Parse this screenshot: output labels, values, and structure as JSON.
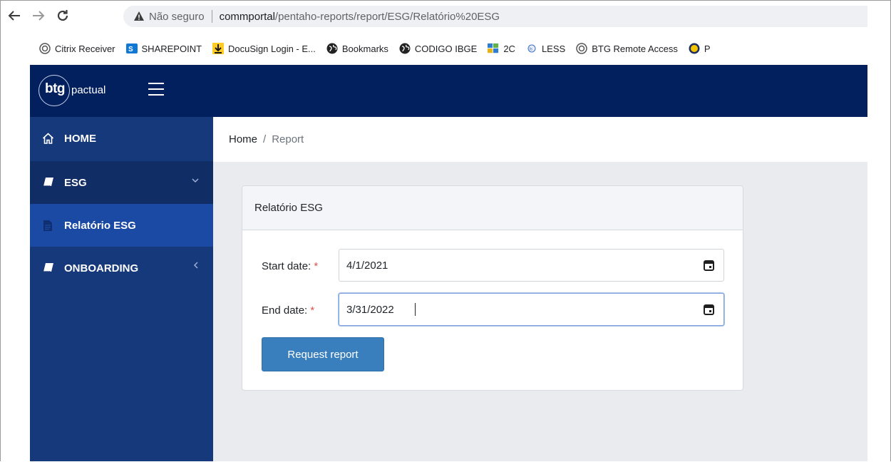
{
  "browser": {
    "security_text": "Não seguro",
    "url_host": "commportal",
    "url_path": "/pentaho-reports/report/ESG/Relatório%20ESG",
    "bookmarks": [
      {
        "label": "Citrix Receiver",
        "icon": "citrix-icon"
      },
      {
        "label": "SHAREPOINT",
        "icon": "sharepoint-icon"
      },
      {
        "label": "DocuSign Login - E...",
        "icon": "docusign-icon"
      },
      {
        "label": "Bookmarks",
        "icon": "globe-icon"
      },
      {
        "label": "CODIGO IBGE",
        "icon": "globe-icon"
      },
      {
        "label": "2C",
        "icon": "grid-icon"
      },
      {
        "label": "LESS",
        "icon": "less-icon"
      },
      {
        "label": "BTG Remote Access",
        "icon": "citrix-icon"
      },
      {
        "label": "P",
        "icon": "yellow-circle-icon"
      }
    ]
  },
  "header": {
    "logo_brand": "btg",
    "logo_suffix": "pactual"
  },
  "sidebar": {
    "items": [
      {
        "label": "HOME",
        "icon": "home-icon"
      },
      {
        "label": "ESG",
        "icon": "book-icon",
        "expanded": true
      },
      {
        "label": "Relatório ESG",
        "icon": "document-icon",
        "active": true
      },
      {
        "label": "ONBOARDING",
        "icon": "book-icon",
        "expanded": false
      }
    ]
  },
  "breadcrumb": {
    "home": "Home",
    "separator": "/",
    "current": "Report"
  },
  "card": {
    "title": "Relatório ESG",
    "start_label": "Start date:",
    "start_value": "4/1/2021",
    "end_label": "End date:",
    "end_value": "3/31/2022",
    "required_mark": "*",
    "submit_label": "Request report"
  },
  "colors": {
    "header_bg": "#01205d",
    "sidebar_bg": "#15397a",
    "sidebar_active": "#1b4aa4",
    "button_bg": "#3a7fbd",
    "required": "#d9534f"
  }
}
